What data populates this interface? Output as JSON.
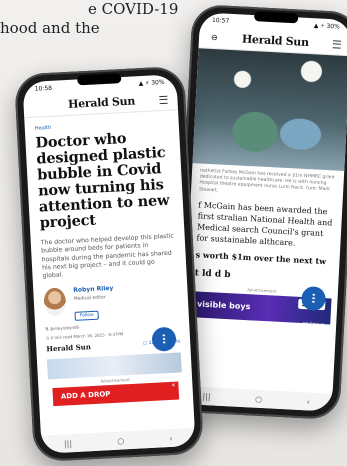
{
  "background_text": [
    "e COVID-19",
    "hood and the"
  ],
  "back_phone": {
    "status_time": "10:57",
    "status_right": "▲ ⚡ 30%",
    "logo": "Herald Sun",
    "caption": "nathetist Forbes McGain has received a $1m NHMRC grant dedicated to sustainable healthcare. He is with nursing Hospital theatre equipment nurse Lumi Racic. ture: Mark Stewart.",
    "para1": "f McGain has been awarded the first stralian National Health and Medical search Council's grant for sustainable althcare.",
    "para2": "s worth $1m over the next tw",
    "para3": "t ld d b",
    "ad_label": "Advertisement",
    "ad_text": "visible boys",
    "ad_brand": "Stan.",
    "ad_brand_sub": "ORIGINALS",
    "fab_icon": "ⵗ",
    "nav": [
      "|||",
      "○",
      "‹"
    ]
  },
  "front_phone": {
    "status_time": "10:58",
    "status_right": "▲ ⚡ 30%",
    "logo": "Herald Sun",
    "section": "Health",
    "headline": "Doctor who designed plastic bubble in Covid now turning his attention to new project",
    "standfirst": "The doctor who helped develop this plastic bubble around beds for patients in hospitals during the pandemic has shared his next big project – and it could go global.",
    "author": "Robyn Riley",
    "role": "Medical editor",
    "follow": "Follow",
    "handle": "@rileyrobyn06",
    "meta": "2 min read  March 16, 2023 · 9:37PM",
    "small_logo": "Herald Sun",
    "comments": "12 Comments",
    "ad_label": "Advertisement",
    "ad_text": "ADD A DROP",
    "fab_icon": "ⵗ",
    "nav": [
      "|||",
      "○",
      "‹"
    ]
  }
}
